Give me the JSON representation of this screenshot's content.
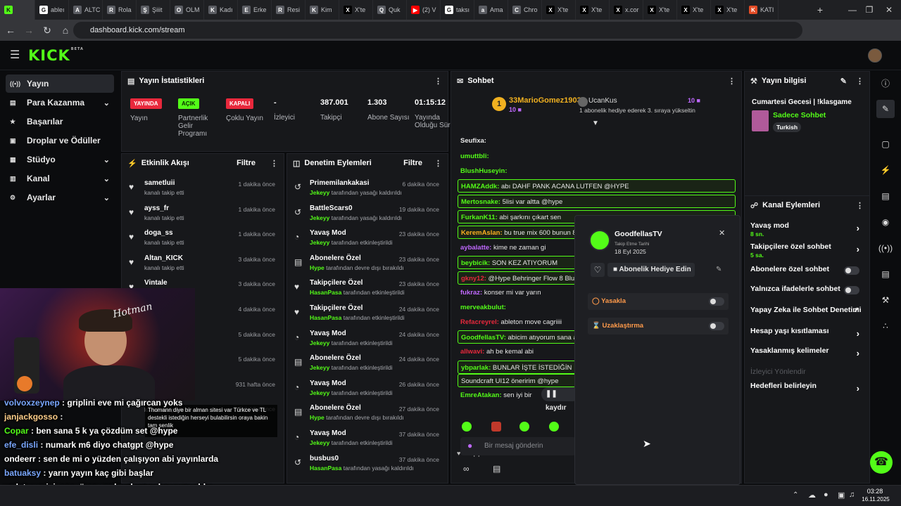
{
  "browser": {
    "tabs": [
      {
        "label": "",
        "icon": "K",
        "color": "#53fc18"
      },
      {
        "label": "ableı",
        "icon": "G",
        "color": "#ffffff"
      },
      {
        "label": "ALTC",
        "icon": "A",
        "color": "#5b5d63"
      },
      {
        "label": "Rola",
        "icon": "R",
        "color": "#5b5d63"
      },
      {
        "label": "Şiiit",
        "icon": "Ş",
        "color": "#5b5d63"
      },
      {
        "label": "OLM",
        "icon": "O",
        "color": "#5b5d63"
      },
      {
        "label": "Kadı",
        "icon": "K",
        "color": "#5b5d63"
      },
      {
        "label": "Erke",
        "icon": "E",
        "color": "#5b5d63"
      },
      {
        "label": "Resi",
        "icon": "R",
        "color": "#5b5d63"
      },
      {
        "label": "Kim",
        "icon": "K",
        "color": "#5b5d63"
      },
      {
        "label": "X'te",
        "icon": "X",
        "color": "#000000"
      },
      {
        "label": "Quk",
        "icon": "Q",
        "color": "#5b5d63"
      },
      {
        "label": "(2) V",
        "icon": "▶",
        "color": "#ff0000"
      },
      {
        "label": "taksı",
        "icon": "G",
        "color": "#ffffff"
      },
      {
        "label": "Ama",
        "icon": "a",
        "color": "#5b5d63"
      },
      {
        "label": "Chro",
        "icon": "C",
        "color": "#5b5d63"
      },
      {
        "label": "X'te",
        "icon": "X",
        "color": "#000000"
      },
      {
        "label": "X'te",
        "icon": "X",
        "color": "#000000"
      },
      {
        "label": "x.cor",
        "icon": "X",
        "color": "#000000"
      },
      {
        "label": "X'te",
        "icon": "X",
        "color": "#000000"
      },
      {
        "label": "X'te",
        "icon": "X",
        "color": "#000000"
      },
      {
        "label": "X'te",
        "icon": "X",
        "color": "#000000"
      },
      {
        "label": "KATI",
        "icon": "K",
        "color": "#e34c26"
      }
    ],
    "url": "dashboard.kick.com/stream"
  },
  "kick": {
    "logo": "KICK",
    "logo_sup": "BETA"
  },
  "nav": [
    {
      "label": "Yayın",
      "icon": "((•))",
      "chev": ""
    },
    {
      "label": "Para Kazanma",
      "icon": "▤",
      "chev": "⌄"
    },
    {
      "label": "Başarılar",
      "icon": "★",
      "chev": ""
    },
    {
      "label": "Droplar ve Ödüller",
      "icon": "▣",
      "chev": ""
    },
    {
      "label": "Stüdyo",
      "icon": "▦",
      "chev": "⌄"
    },
    {
      "label": "Kanal",
      "icon": "▥",
      "chev": "⌄"
    },
    {
      "label": "Ayarlar",
      "icon": "⚙",
      "chev": "⌄"
    }
  ],
  "stats": {
    "title": "Yayın İstatistikleri",
    "items": [
      {
        "badge": "YAYINDA",
        "color": "#e8283c",
        "label": "Yayın"
      },
      {
        "badge": "AÇIK",
        "color": "#53fc18",
        "label": "Partnerlik Gelir Programı"
      },
      {
        "badge": "KAPALI",
        "color": "#e8283c",
        "label": "Çoklu Yayın"
      },
      {
        "value": "-",
        "label": "İzleyici"
      },
      {
        "value": "387.001",
        "label": "Takipçi"
      },
      {
        "value": "1.303",
        "label": "Abone Sayısı"
      },
      {
        "value": "01:15:12",
        "label": "Yayında Olduğu Süre"
      }
    ]
  },
  "activity": {
    "title": "Etkinlik Akışı",
    "filter": "Filtre",
    "rows": [
      {
        "name": "sametluii",
        "sub": "kanalı takip etti",
        "time": "1 dakika önce"
      },
      {
        "name": "ayss_fr",
        "sub": "kanalı takip etti",
        "time": "1 dakika önce"
      },
      {
        "name": "doga_ss",
        "sub": "kanalı takip etti",
        "time": "1 dakika önce"
      },
      {
        "name": "Altan_KICK",
        "sub": "kanalı takip etti",
        "time": "3 dakika önce"
      },
      {
        "name": "Vintale",
        "sub": "",
        "time": "3 dakika önce"
      },
      {
        "name": "",
        "sub": "",
        "time": "4 dakika önce"
      },
      {
        "name": "",
        "sub": "",
        "time": "5 dakika önce"
      },
      {
        "name": "",
        "sub": "",
        "time": "5 dakika önce"
      },
      {
        "name": "",
        "sub": "",
        "time": "931 hafta önce"
      },
      {
        "name": "",
        "sub": "kanalı takip etti",
        "time": "7 dakika önce"
      }
    ]
  },
  "moderation": {
    "title": "Denetim Eylemleri",
    "filter": "Filtre",
    "rows": [
      {
        "icon": "↺",
        "title": "Primemilankakasi",
        "by": "Jekeyy",
        "desc": " tarafından yasağı kaldırıldı",
        "time": "6 dakika önce"
      },
      {
        "icon": "↺",
        "title": "BattleScars0",
        "by": "Jekeyy",
        "desc": " tarafından yasağı kaldırıldı",
        "time": "19 dakika önce"
      },
      {
        "icon": "◔",
        "title": "Yavaş Mod",
        "by": "Jekeyy",
        "desc": " tarafından etkinleştirildi",
        "time": "23 dakika önce"
      },
      {
        "icon": "▤",
        "title": "Abonelere Özel",
        "by": "Hype",
        "desc": " tarafından devre dışı bırakıldı",
        "time": "23 dakika önce"
      },
      {
        "icon": "♥",
        "title": "Takipçilere Özel",
        "by": "HasanPasa",
        "desc": " tarafından etkinleştirildi",
        "time": "23 dakika önce"
      },
      {
        "icon": "♥",
        "title": "Takipçilere Özel",
        "by": "HasanPasa",
        "desc": " tarafından etkinleştirildi",
        "time": "24 dakika önce"
      },
      {
        "icon": "◔",
        "title": "Yavaş Mod",
        "by": "Jekeyy",
        "desc": " tarafından etkinleştirildi",
        "time": "24 dakika önce"
      },
      {
        "icon": "▤",
        "title": "Abonelere Özel",
        "by": "Jekeyy",
        "desc": " tarafından etkinleştirildi",
        "time": "24 dakika önce"
      },
      {
        "icon": "◔",
        "title": "Yavaş Mod",
        "by": "Jekeyy",
        "desc": " tarafından etkinleştirildi",
        "time": "26 dakika önce"
      },
      {
        "icon": "▤",
        "title": "Abonelere Özel",
        "by": "Hype",
        "desc": " tarafından devre dışı bırakıldı",
        "time": "27 dakika önce"
      },
      {
        "icon": "◔",
        "title": "Yavaş Mod",
        "by": "Jekeyy",
        "desc": " tarafından etkinleştirildi",
        "time": "37 dakika önce"
      },
      {
        "icon": "↺",
        "title": "busbus0",
        "by": "HasanPasa",
        "desc": " tarafından yasağı kaldırıldı",
        "time": "37 dakika önce"
      }
    ]
  },
  "chat": {
    "title": "Sohbet",
    "top_gifter": {
      "rank": "1",
      "name": "33MarioGomez1903",
      "count": "10"
    },
    "gift_info": {
      "name": "UcanKus",
      "count": "10",
      "text": "1 abonelik hediye ederek 3. sıraya yükseltin"
    },
    "lines": [
      {
        "user": "Seufixa:",
        "text": "",
        "color": "#e8e8e8",
        "box": false
      },
      {
        "user": "umuttbli:",
        "text": "",
        "color": "#53fc18",
        "box": false
      },
      {
        "user": "BlushHuseyin:",
        "text": "",
        "color": "#53fc18",
        "box": false
      },
      {
        "user": "HAMZAddk:",
        "text": " abı DAHF PANK ACANA LUTFEN @HYPE",
        "color": "#53fc18",
        "box": true
      },
      {
        "user": "Mertosnake:",
        "text": " 5lisi var altta @hype",
        "color": "#53fc18",
        "box": true
      },
      {
        "user": "FurkanK11:",
        "text": " abi şarkını çıkart sen",
        "color": "#53fc18",
        "box": true
      },
      {
        "user": "KeremAslan:",
        "text": " bu true mix 600 bunun 80",
        "color": "#ffb020",
        "box": true
      },
      {
        "user": "aybalatte:",
        "text": " kime ne zaman gi",
        "color": "#c069ff",
        "box": false
      },
      {
        "user": "beybicik:",
        "text": " SON KEZ ATIYORUM",
        "color": "#53fc18",
        "box": true
      },
      {
        "user": "gkny12:",
        "text": " @Hype Behringer Flow 8 Blueto",
        "color": "#e8283c",
        "box": true
      },
      {
        "user": "fukraz:",
        "text": " konser mi var yarın",
        "color": "#c069ff",
        "box": false
      },
      {
        "user": "merveakbulut:",
        "text": "",
        "color": "#53fc18",
        "box": false
      },
      {
        "user": "Refacreyrel:",
        "text": " ableton move cagriiii",
        "color": "#e8283c",
        "box": false
      },
      {
        "user": "GoodfellasTV:",
        "text": " abicim atıyorum sana am",
        "color": "#53fc18",
        "box": true
      },
      {
        "user": "allwavi:",
        "text": " ah be kemal abi",
        "color": "#e8283c",
        "box": false
      },
      {
        "user": "ybparlak:",
        "text": " BUNLAR İŞTE İSTEDİĞİN",
        "color": "#53fc18",
        "box": true
      },
      {
        "user": "",
        "text": "Soundcraft UI12 öneririm @hype",
        "color": "#53fc18",
        "box": true
      },
      {
        "user": "EmreAtakan:",
        "text": " sen iyi bir",
        "color": "#53fc18",
        "box": false
      }
    ],
    "paused": "kaydır",
    "followers_only": "Takipçilere Özel",
    "placeholder": "Bir mesaj gönderin"
  },
  "popup": {
    "name": "GoodfellasTV",
    "follow_label": "Takip Etme Tarihi",
    "follow_date": "18 Eyl 2025",
    "gift_button": "Abonelik Hediye Edin",
    "ban": "Yasakla",
    "timeout": "Uzaklaştırma"
  },
  "stream_info": {
    "title": "Yayın bilgisi",
    "stream_title": "Cumartesi Gecesi | !klasgame",
    "category": "Sadece Sohbet",
    "tag": "Turkish"
  },
  "channel_actions": {
    "title": "Kanal Eylemleri",
    "rows": [
      {
        "label": "Yavaş mod",
        "sub": "8 sn.",
        "kind": "chev"
      },
      {
        "label": "Takipçilere özel sohbet",
        "sub": "5 sa.",
        "kind": "chev"
      },
      {
        "label": "Abonelere özel sohbet",
        "sub": "",
        "kind": "toggle"
      },
      {
        "label": "Yalnızca ifadelerle sohbet",
        "sub": "",
        "kind": "toggle"
      },
      {
        "label": "Yapay Zeka ile Sohbet Denetimi",
        "sub": "",
        "kind": "ext"
      },
      {
        "label": "Hesap yaşı kısıtlaması",
        "sub": "",
        "kind": "chev"
      },
      {
        "label": "Yasaklanmış kelimeler",
        "sub": "",
        "kind": "chev"
      },
      {
        "label": "İzleyici Yönlendir",
        "sub": "",
        "kind": "disabled"
      },
      {
        "label": "Hedefleri belirleyin",
        "sub": "",
        "kind": "chev"
      }
    ]
  },
  "overlay": {
    "tooltip": "Thomann diye bir alman sitesi var Türkce ve TL destekli istediğin herseyi bulabilirsin oraya bakin tam senlik",
    "cam_sign": "Hotman",
    "lines": [
      {
        "user": "volvoxzeynep",
        "text": " : griplini eve mi çağırcan yoks",
        "color": "#7aa7ff"
      },
      {
        "user": "janjackgosso",
        "text": " :",
        "color": "#ffcf8a"
      },
      {
        "user": "Copar",
        "text": " : ben sana 5 k ya çözdüm set @hype",
        "color": "#53fc18"
      },
      {
        "user": "efe_disli",
        "text": " : numark m6 diyo chatgpt @hype",
        "color": "#7aa7ff"
      },
      {
        "user": "ondeerr",
        "text": " : sen de mi o yüzden çalışıyon abi yayınlarda",
        "color": "#ffffff"
      },
      {
        "user": "batuaksy",
        "text": " : yarın yayın kaç gibi başlar",
        "color": "#7aa7ff"
      },
      {
        "user": "wnlety",
        "text": " : reisi sene önce şarkı çıkarıyodun o ne oldu",
        "color": "#ffffff"
      }
    ]
  },
  "taskbar": {
    "time": "03:28",
    "date": "16.11.2025"
  }
}
